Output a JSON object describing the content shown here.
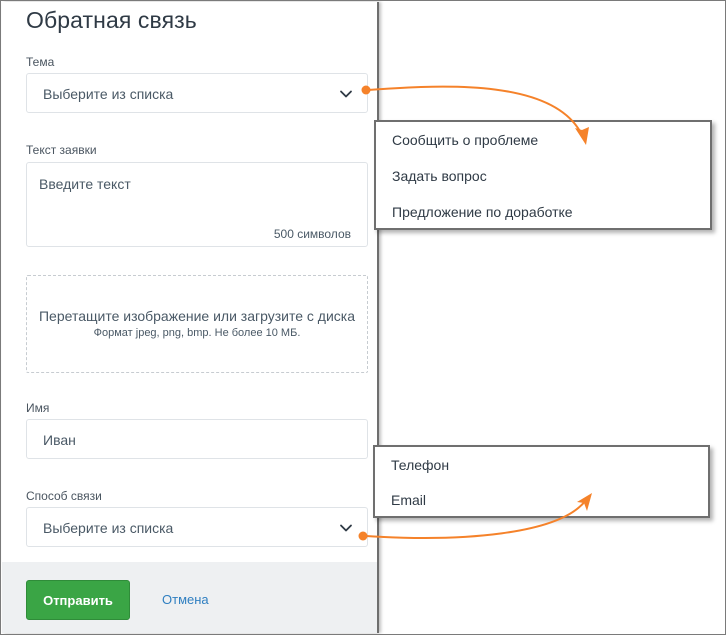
{
  "form": {
    "title": "Обратная связь",
    "topic": {
      "label": "Тема",
      "value": "Выберите из списка"
    },
    "request_text": {
      "label": "Текст заявки",
      "placeholder": "Введите текст",
      "counter": "500 символов"
    },
    "upload": {
      "text": "Перетащите изображение или загрузите с диска",
      "hint": "Формат jpeg, png, bmp. Не более 10 МБ."
    },
    "name": {
      "label": "Имя",
      "value": "Иван"
    },
    "contact_method": {
      "label": "Способ связи",
      "value": "Выберите из списка"
    },
    "actions": {
      "submit": "Отправить",
      "cancel": "Отмена"
    }
  },
  "topic_dropdown": {
    "options": [
      "Сообщить о проблеме",
      "Задать вопрос",
      "Предложение по доработке"
    ]
  },
  "contact_dropdown": {
    "options": [
      "Телефон",
      "Email"
    ]
  },
  "colors": {
    "accent_orange": "#f5822a",
    "submit_green": "#3aa545",
    "link_blue": "#2f7fc1"
  },
  "icons": {
    "select_arrow": "chevron-down-icon",
    "callout_dot": "dot-icon",
    "callout_arrow": "curved-arrow-icon"
  }
}
